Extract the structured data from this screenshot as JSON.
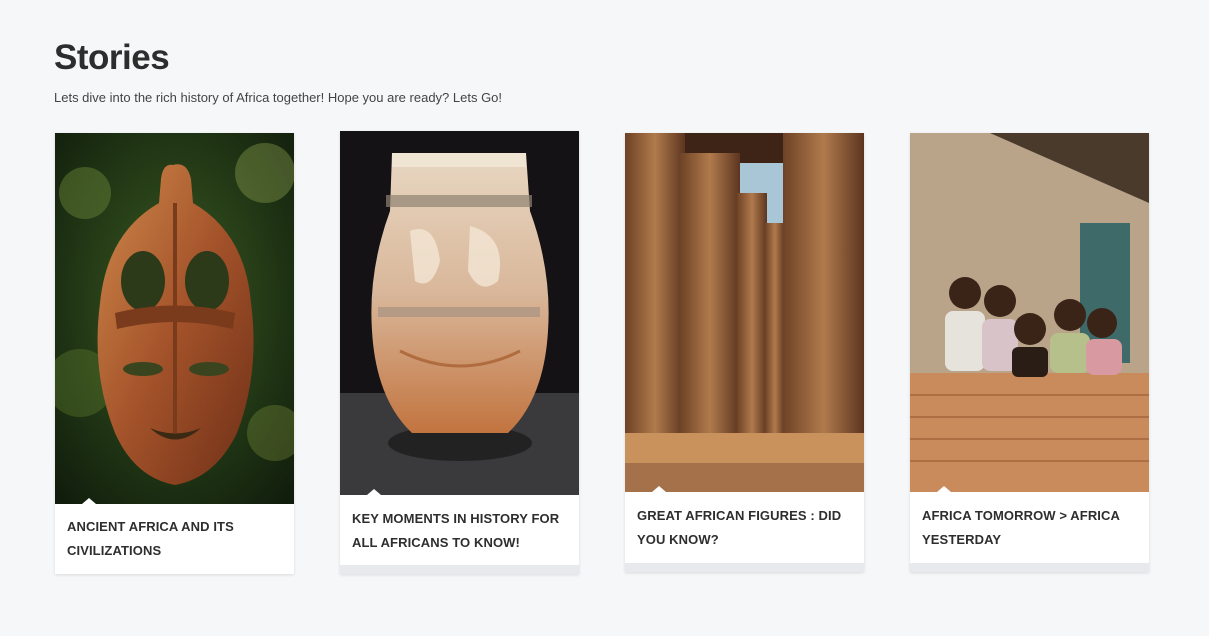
{
  "section": {
    "title": "Stories",
    "subtitle": "Lets dive into the rich history of Africa together! Hope you are ready? Lets Go!"
  },
  "cards": [
    {
      "title": "ANCIENT AFRICA AND ITS CIVILIZATIONS",
      "image": "carved-wooden-mask-image"
    },
    {
      "title": "KEY MOMENTS IN HISTORY FOR ALL AFRICANS TO KNOW!",
      "image": "carved-alabaster-vase-image"
    },
    {
      "title": "GREAT AFRICAN FIGURES : DID YOU KNOW?",
      "image": "ancient-temple-columns-image"
    },
    {
      "title": "AFRICA TOMORROW > AFRICA YESTERDAY",
      "image": "smiling-children-at-wall-image"
    }
  ]
}
